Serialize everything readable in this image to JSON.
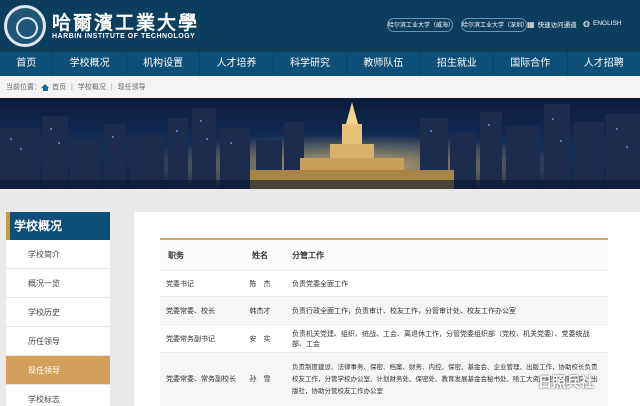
{
  "header": {
    "logo_cn": "哈爾濱工業大學",
    "logo_en": "HARBIN INSTITUTE OF TECHNOLOGY",
    "ext_links": [
      "哈尔滨工业大学（威海）",
      "哈尔滨工业大学（深圳）"
    ],
    "quick_link": "快速访问通道",
    "lang_link": "ENGLISH"
  },
  "nav": [
    "首页",
    "学校概况",
    "机构设置",
    "人才培养",
    "科学研究",
    "教师队伍",
    "招生就业",
    "国际合作",
    "人才招聘"
  ],
  "breadcrumb": {
    "label": "当前位置：",
    "items": [
      "首页",
      "学校概况",
      "现任领导"
    ],
    "sep": "|"
  },
  "sidebar": {
    "title": "学校概况",
    "items": [
      "学校简介",
      "概况一览",
      "学校历史",
      "历任领导",
      "现任领导",
      "学校标志"
    ],
    "active_index": 4
  },
  "table": {
    "headers": [
      "职务",
      "姓名",
      "分管工作"
    ],
    "rows": [
      {
        "title": "党委书记",
        "name": "陈　杰",
        "duty": "负责党委全面工作"
      },
      {
        "title": "党委常委、校长",
        "name": "韩杰才",
        "duty": "负责行政全面工作，负责审计、校友工作，分管审计处、校友工作办公室"
      },
      {
        "title": "党委常务副书记",
        "name": "安　实",
        "duty": "负责机关党建、组织、统战、工会、离退休工作，分管党委组织部（党校、机关党委）、党委统战部、工会"
      },
      {
        "title": "党委常委、常务副校长",
        "name": "孙　雪",
        "duty": "负责制度建设、法律事务、保密、档案、财务、内控、保密、基金会、企业管理、出版工作，协助校长负责校友工作，分管学校办公室、计划财务处、保密处、教育发展基金会秘书处、哈工大资产经营有限公司、出版社，协助分管校友工作办公室"
      }
    ]
  },
  "watermark": "日照兵社",
  "colors": {
    "header": "#0b3d5c",
    "nav": "#0d4f79",
    "accent": "#d2a05a"
  }
}
